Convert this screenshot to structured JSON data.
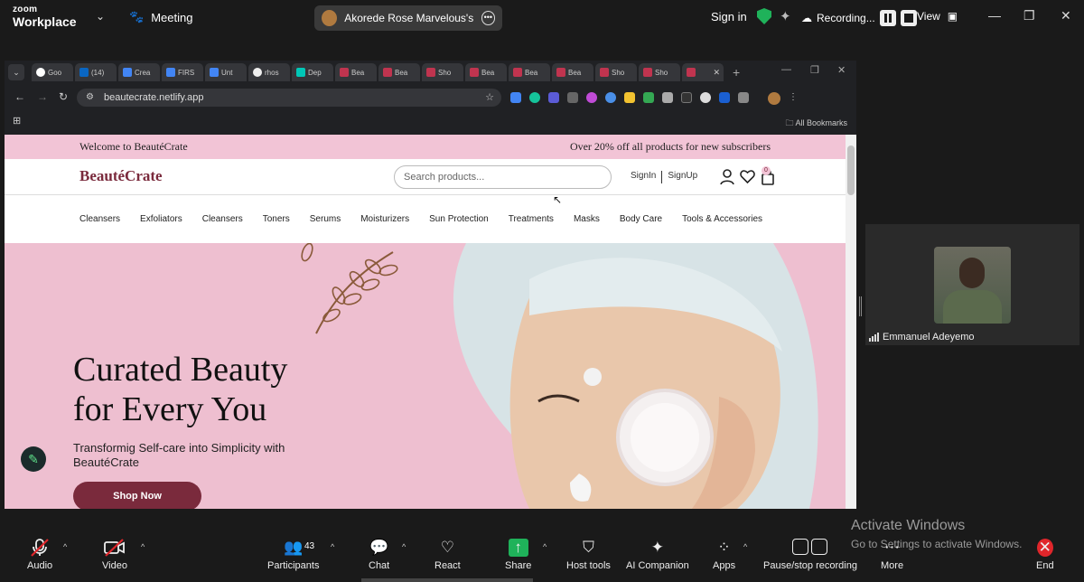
{
  "zoom": {
    "logo_line1": "zoom",
    "logo_line2": "Workplace",
    "meeting_label": "Meeting",
    "share_label": "Akorede Rose Marvelous's screen",
    "sign_in": "Sign in",
    "recording_label": "Recording...",
    "view_label": "View"
  },
  "browser": {
    "tabs": [
      {
        "label": "Goo",
        "color": "#ffffff"
      },
      {
        "label": "(14)",
        "color": "#0a66c2"
      },
      {
        "label": "Crea",
        "color": "#4285f4"
      },
      {
        "label": "FIRS",
        "color": "#4285f4"
      },
      {
        "label": "Unt",
        "color": "#4285f4"
      },
      {
        "label": "rhos",
        "color": "#eeeeee"
      },
      {
        "label": "Dep",
        "color": "#00c7b7"
      },
      {
        "label": "Bea",
        "color": "#c0344f"
      },
      {
        "label": "Bea",
        "color": "#c0344f"
      },
      {
        "label": "Sho",
        "color": "#c0344f"
      },
      {
        "label": "Bea",
        "color": "#c0344f"
      },
      {
        "label": "Bea",
        "color": "#c0344f"
      },
      {
        "label": "Bea",
        "color": "#c0344f"
      },
      {
        "label": "Sho",
        "color": "#c0344f"
      },
      {
        "label": "Sho",
        "color": "#c0344f"
      },
      {
        "label": "",
        "color": "#c0344f"
      }
    ],
    "url": "beautecrate.netlify.app",
    "all_bookmarks": "All Bookmarks"
  },
  "site": {
    "promo_left": "Welcome to BeautéCrate",
    "promo_right": "Over 20% off all products for new subscribers",
    "brand": "BeautéCrate",
    "search_placeholder": "Search products...",
    "signin": "SignIn",
    "signup": "SignUp",
    "cart_count": "0",
    "nav": [
      "Cleansers",
      "Exfoliators",
      "Cleansers",
      "Toners",
      "Serums",
      "Moisturizers",
      "Sun Protection",
      "Treatments",
      "Masks",
      "Body Care",
      "Tools & Accessories"
    ],
    "hero_title_1": "Curated Beauty",
    "hero_title_2": "for Every You",
    "hero_sub": "Transformig Self-care into Simplicity with BeautéCrate",
    "shop_now": "Shop Now"
  },
  "participant": {
    "name": "Emmanuel Adeyemo"
  },
  "watermark": {
    "title": "Activate Windows",
    "sub": "Go to Settings to activate Windows."
  },
  "toolbar": {
    "audio": "Audio",
    "video": "Video",
    "participants": "Participants",
    "participants_count": "43",
    "chat": "Chat",
    "react": "React",
    "share": "Share",
    "host_tools": "Host tools",
    "ai_companion": "AI Companion",
    "apps": "Apps",
    "pause_stop": "Pause/stop recording",
    "more": "More",
    "end": "End"
  }
}
